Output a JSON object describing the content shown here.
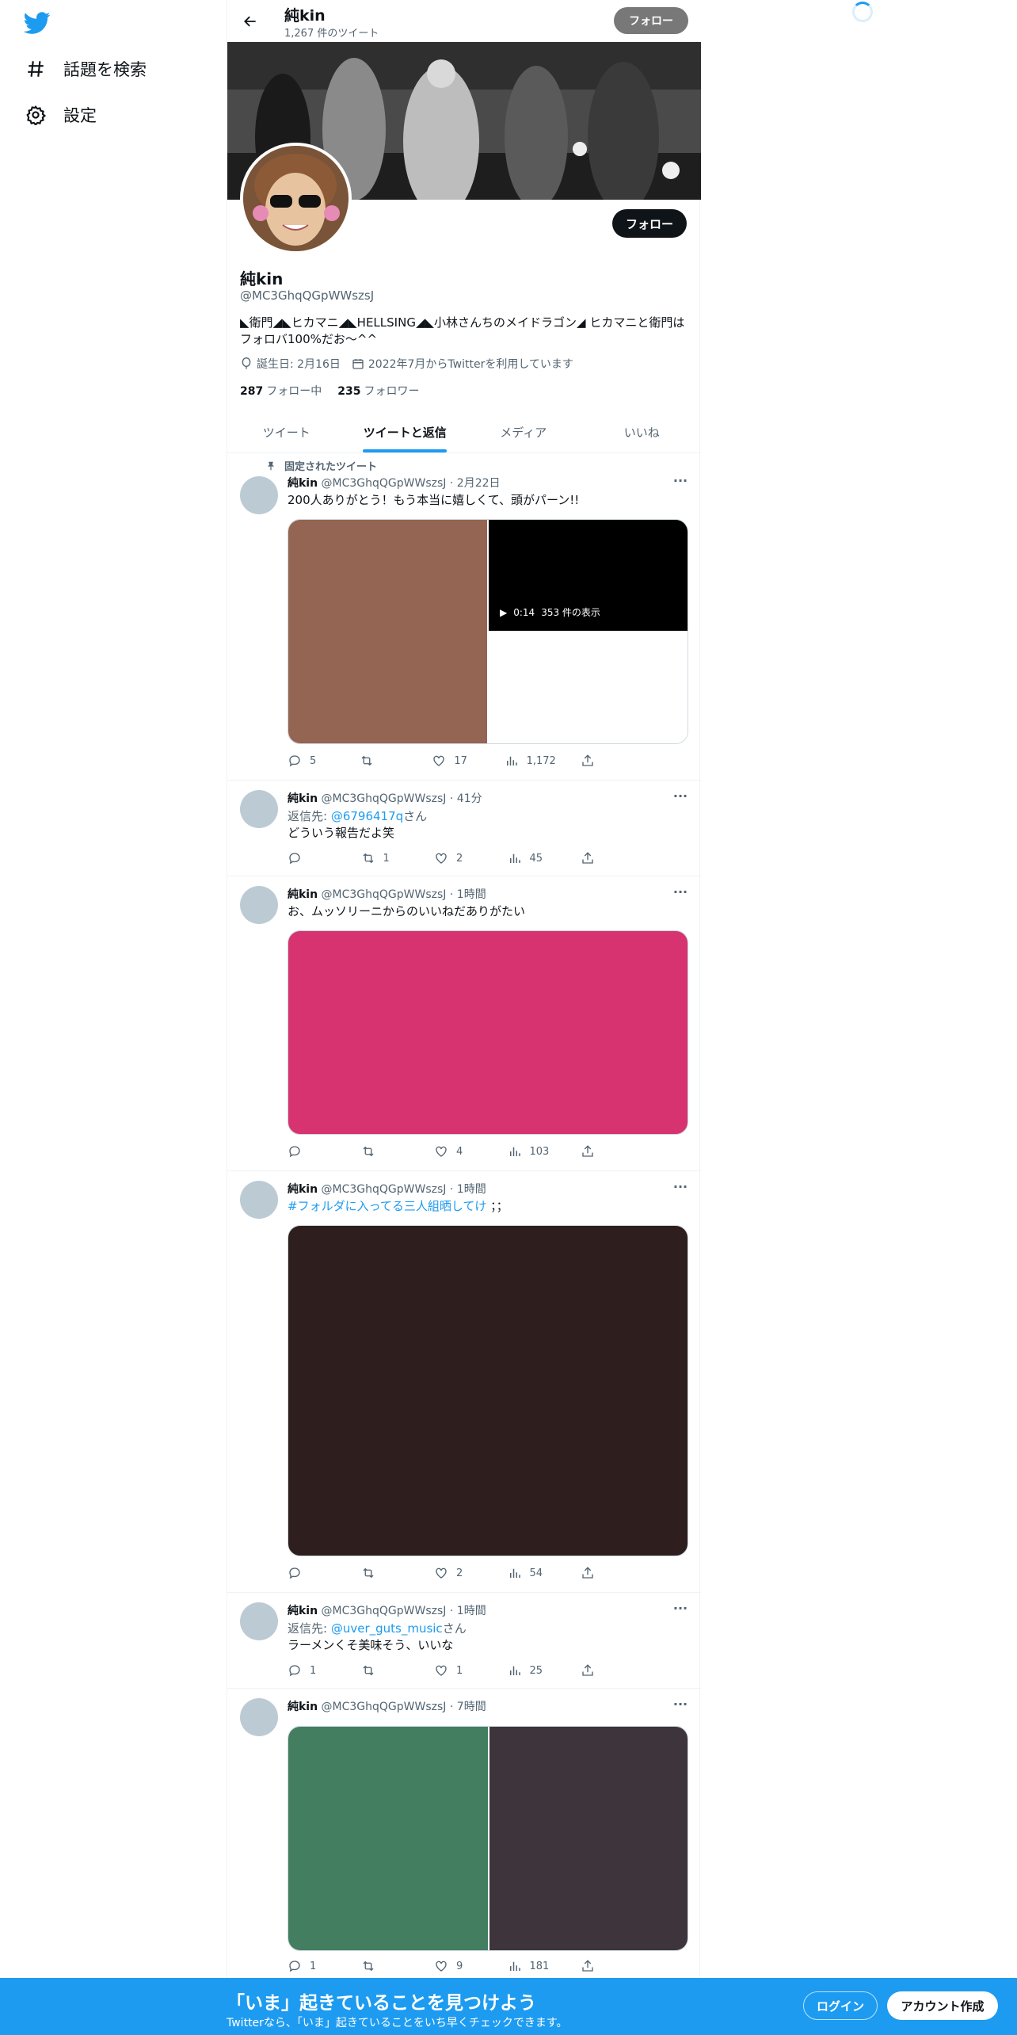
{
  "nav": {
    "explore_label": "話題を検索",
    "settings_label": "設定"
  },
  "header": {
    "name": "純kin",
    "tweet_count": "1,267 件のツイート",
    "follow_label": "フォロー"
  },
  "profile": {
    "name": "純kin",
    "handle": "@MC3GhqQGpWWszsJ",
    "bio": "◣衛門◢◣ヒカマニ◢◣HELLSING◢◣小林さんちのメイドラゴン◢ ヒカマニと衛門はフォロバ100%だお〜^^",
    "birthday": "誕生日: 2月16日",
    "joined": "2022年7月からTwitterを利用しています",
    "following_count": "287",
    "following_label": "フォロー中",
    "followers_count": "235",
    "followers_label": "フォロワー",
    "follow_label": "フォロー"
  },
  "tabs": [
    {
      "label": "ツイート"
    },
    {
      "label": "ツイートと返信"
    },
    {
      "label": "メディア"
    },
    {
      "label": "いいね"
    }
  ],
  "tweets": [
    {
      "pinned_label": "固定されたツイート",
      "name": "純kin",
      "handle": "@MC3GhqQGpWWszsJ",
      "time": "2月22日",
      "text": "200人ありがとう！もう本当に嬉しくて、頭がパーン!!",
      "video_time": "0:14",
      "video_views": "353 件の表示",
      "replies": "5",
      "retweets": "",
      "likes": "17",
      "views": "1,172",
      "media_colors": [
        "#946553",
        "#000000",
        "#ffffff"
      ]
    },
    {
      "name": "純kin",
      "handle": "@MC3GhqQGpWWszsJ",
      "time": "41分",
      "reply_prefix": "返信先: ",
      "reply_to": "@6796417q",
      "reply_suffix": "さん",
      "text": "どういう報告だよ笑",
      "replies": "",
      "retweets": "1",
      "likes": "2",
      "views": "45"
    },
    {
      "name": "純kin",
      "handle": "@MC3GhqQGpWWszsJ",
      "time": "1時間",
      "text": "お、ムッソリーニからのいいねだありがたい",
      "replies": "",
      "retweets": "",
      "likes": "4",
      "views": "103",
      "media_colors": [
        "#d73370"
      ]
    },
    {
      "name": "純kin",
      "handle": "@MC3GhqQGpWWszsJ",
      "time": "1時間",
      "hashtag": "#フォルダに入ってる三人組晒してけ",
      "text": "；；",
      "replies": "",
      "retweets": "",
      "likes": "2",
      "views": "54",
      "media_colors": [
        "#2e1e1e"
      ]
    },
    {
      "name": "純kin",
      "handle": "@MC3GhqQGpWWszsJ",
      "time": "1時間",
      "reply_prefix": "返信先: ",
      "reply_to": "@uver_guts_music",
      "reply_suffix": "さん",
      "text": "ラーメンくそ美味そう、いいな",
      "replies": "1",
      "retweets": "",
      "likes": "1",
      "views": "25"
    },
    {
      "name": "純kin",
      "handle": "@MC3GhqQGpWWszsJ",
      "time": "7時間",
      "replies": "1",
      "retweets": "",
      "likes": "9",
      "views": "181",
      "media_colors": [
        "#437e61",
        "#3e343c"
      ]
    }
  ],
  "bottom": {
    "title": "「いま」起きていることを見つけよう",
    "subtitle": "Twitterなら、「いま」起きていることをいち早くチェックできます。",
    "login_label": "ログイン",
    "signup_label": "アカウント作成"
  },
  "colors": {
    "accent": "#1d9bf0",
    "text": "#0f1419",
    "muted": "#536471"
  }
}
